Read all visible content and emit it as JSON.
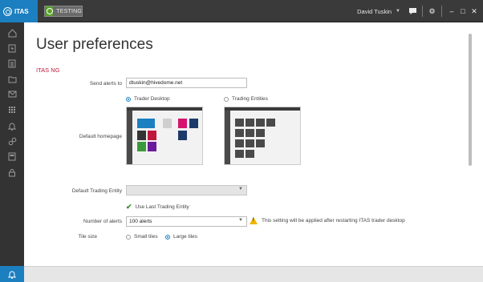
{
  "app": {
    "name": "ITAS",
    "environment": "TESTING"
  },
  "user": {
    "name": "David Tuskin"
  },
  "colors": {
    "accent": "#1b7fc0",
    "section": "#c0183c",
    "env_badge": "#5aa02c",
    "warning": "#f0b400"
  },
  "sidebar": {
    "icons": [
      "home-icon",
      "lightning-icon",
      "documents-icon",
      "folder-icon",
      "mail-icon",
      "grid-icon",
      "bell-icon",
      "link-icon",
      "card-icon",
      "lock-icon"
    ],
    "bottom_icon": "notification-bell-icon"
  },
  "page": {
    "title": "User preferences",
    "section": "ITAS NG"
  },
  "form": {
    "send_alerts_label": "Send alerts to",
    "send_alerts_value": "dtuskin@hivedome.net",
    "default_homepage_label": "Default homepage",
    "homepage_options": [
      {
        "label": "Trader Desktop",
        "selected": true
      },
      {
        "label": "Trading Entities",
        "selected": false
      }
    ],
    "default_trading_entity_label": "Default Trading Entity",
    "default_trading_entity_value": "",
    "use_last_trading_entity": "Use Last Trading Entity",
    "number_of_alerts_label": "Number of alerts",
    "number_of_alerts_value": "100 alerts",
    "restart_warning": "This setting will be applied after restarting ITAS trader desktop",
    "tile_size_label": "Tile size",
    "tile_options": [
      {
        "label": "Small tiles",
        "selected": false
      },
      {
        "label": "Large tiles",
        "selected": true
      }
    ]
  }
}
